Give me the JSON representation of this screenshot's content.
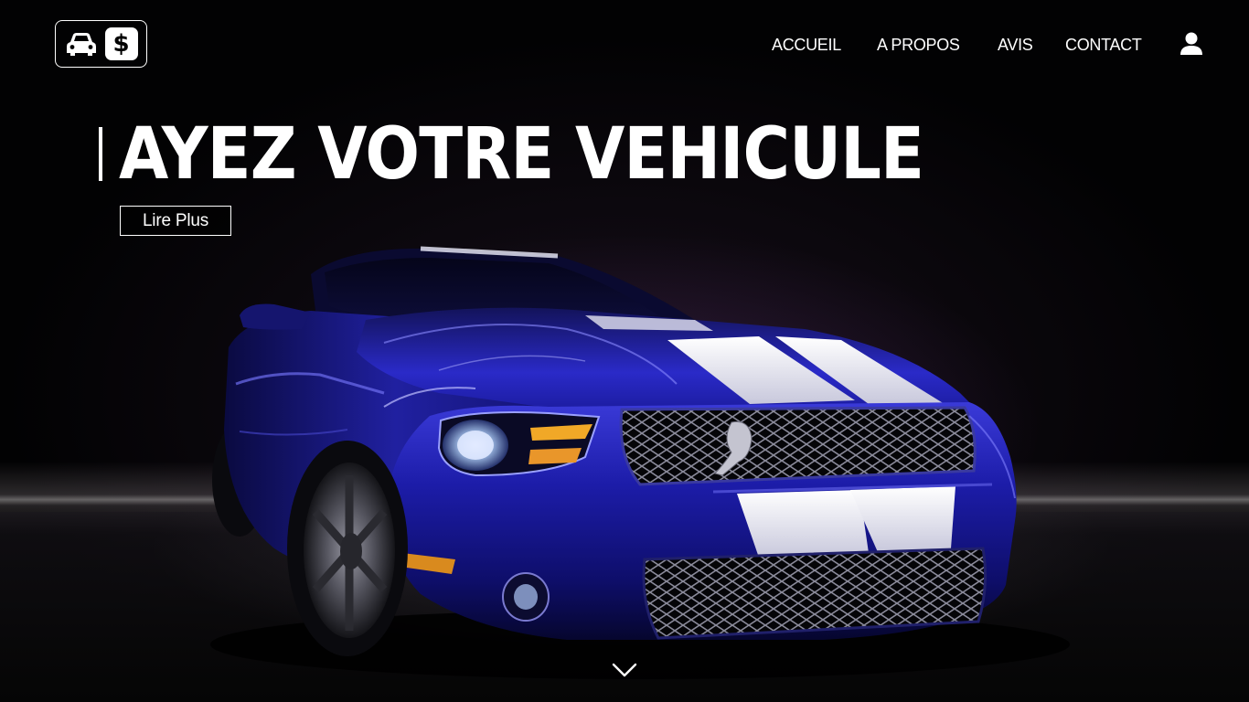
{
  "header": {
    "logo": {
      "icons": [
        "car-icon",
        "dollar-icon"
      ],
      "dollar_glyph": "$"
    },
    "nav": [
      {
        "label": "ACCUEIL"
      },
      {
        "label": "A PROPOS"
      },
      {
        "label": "AVIS"
      },
      {
        "label": "CONTACT"
      }
    ],
    "account_icon": "user-icon"
  },
  "hero": {
    "title": "AYEZ VOTRE VEHICULE",
    "cta_label": "Lire Plus",
    "scroll_icon": "chevron-down-icon",
    "image": "blue sports car with white racing stripes"
  },
  "colors": {
    "background": "#000000",
    "text": "#ffffff",
    "car_body": "#1a1aa8",
    "stripe": "#e8e8f0"
  }
}
